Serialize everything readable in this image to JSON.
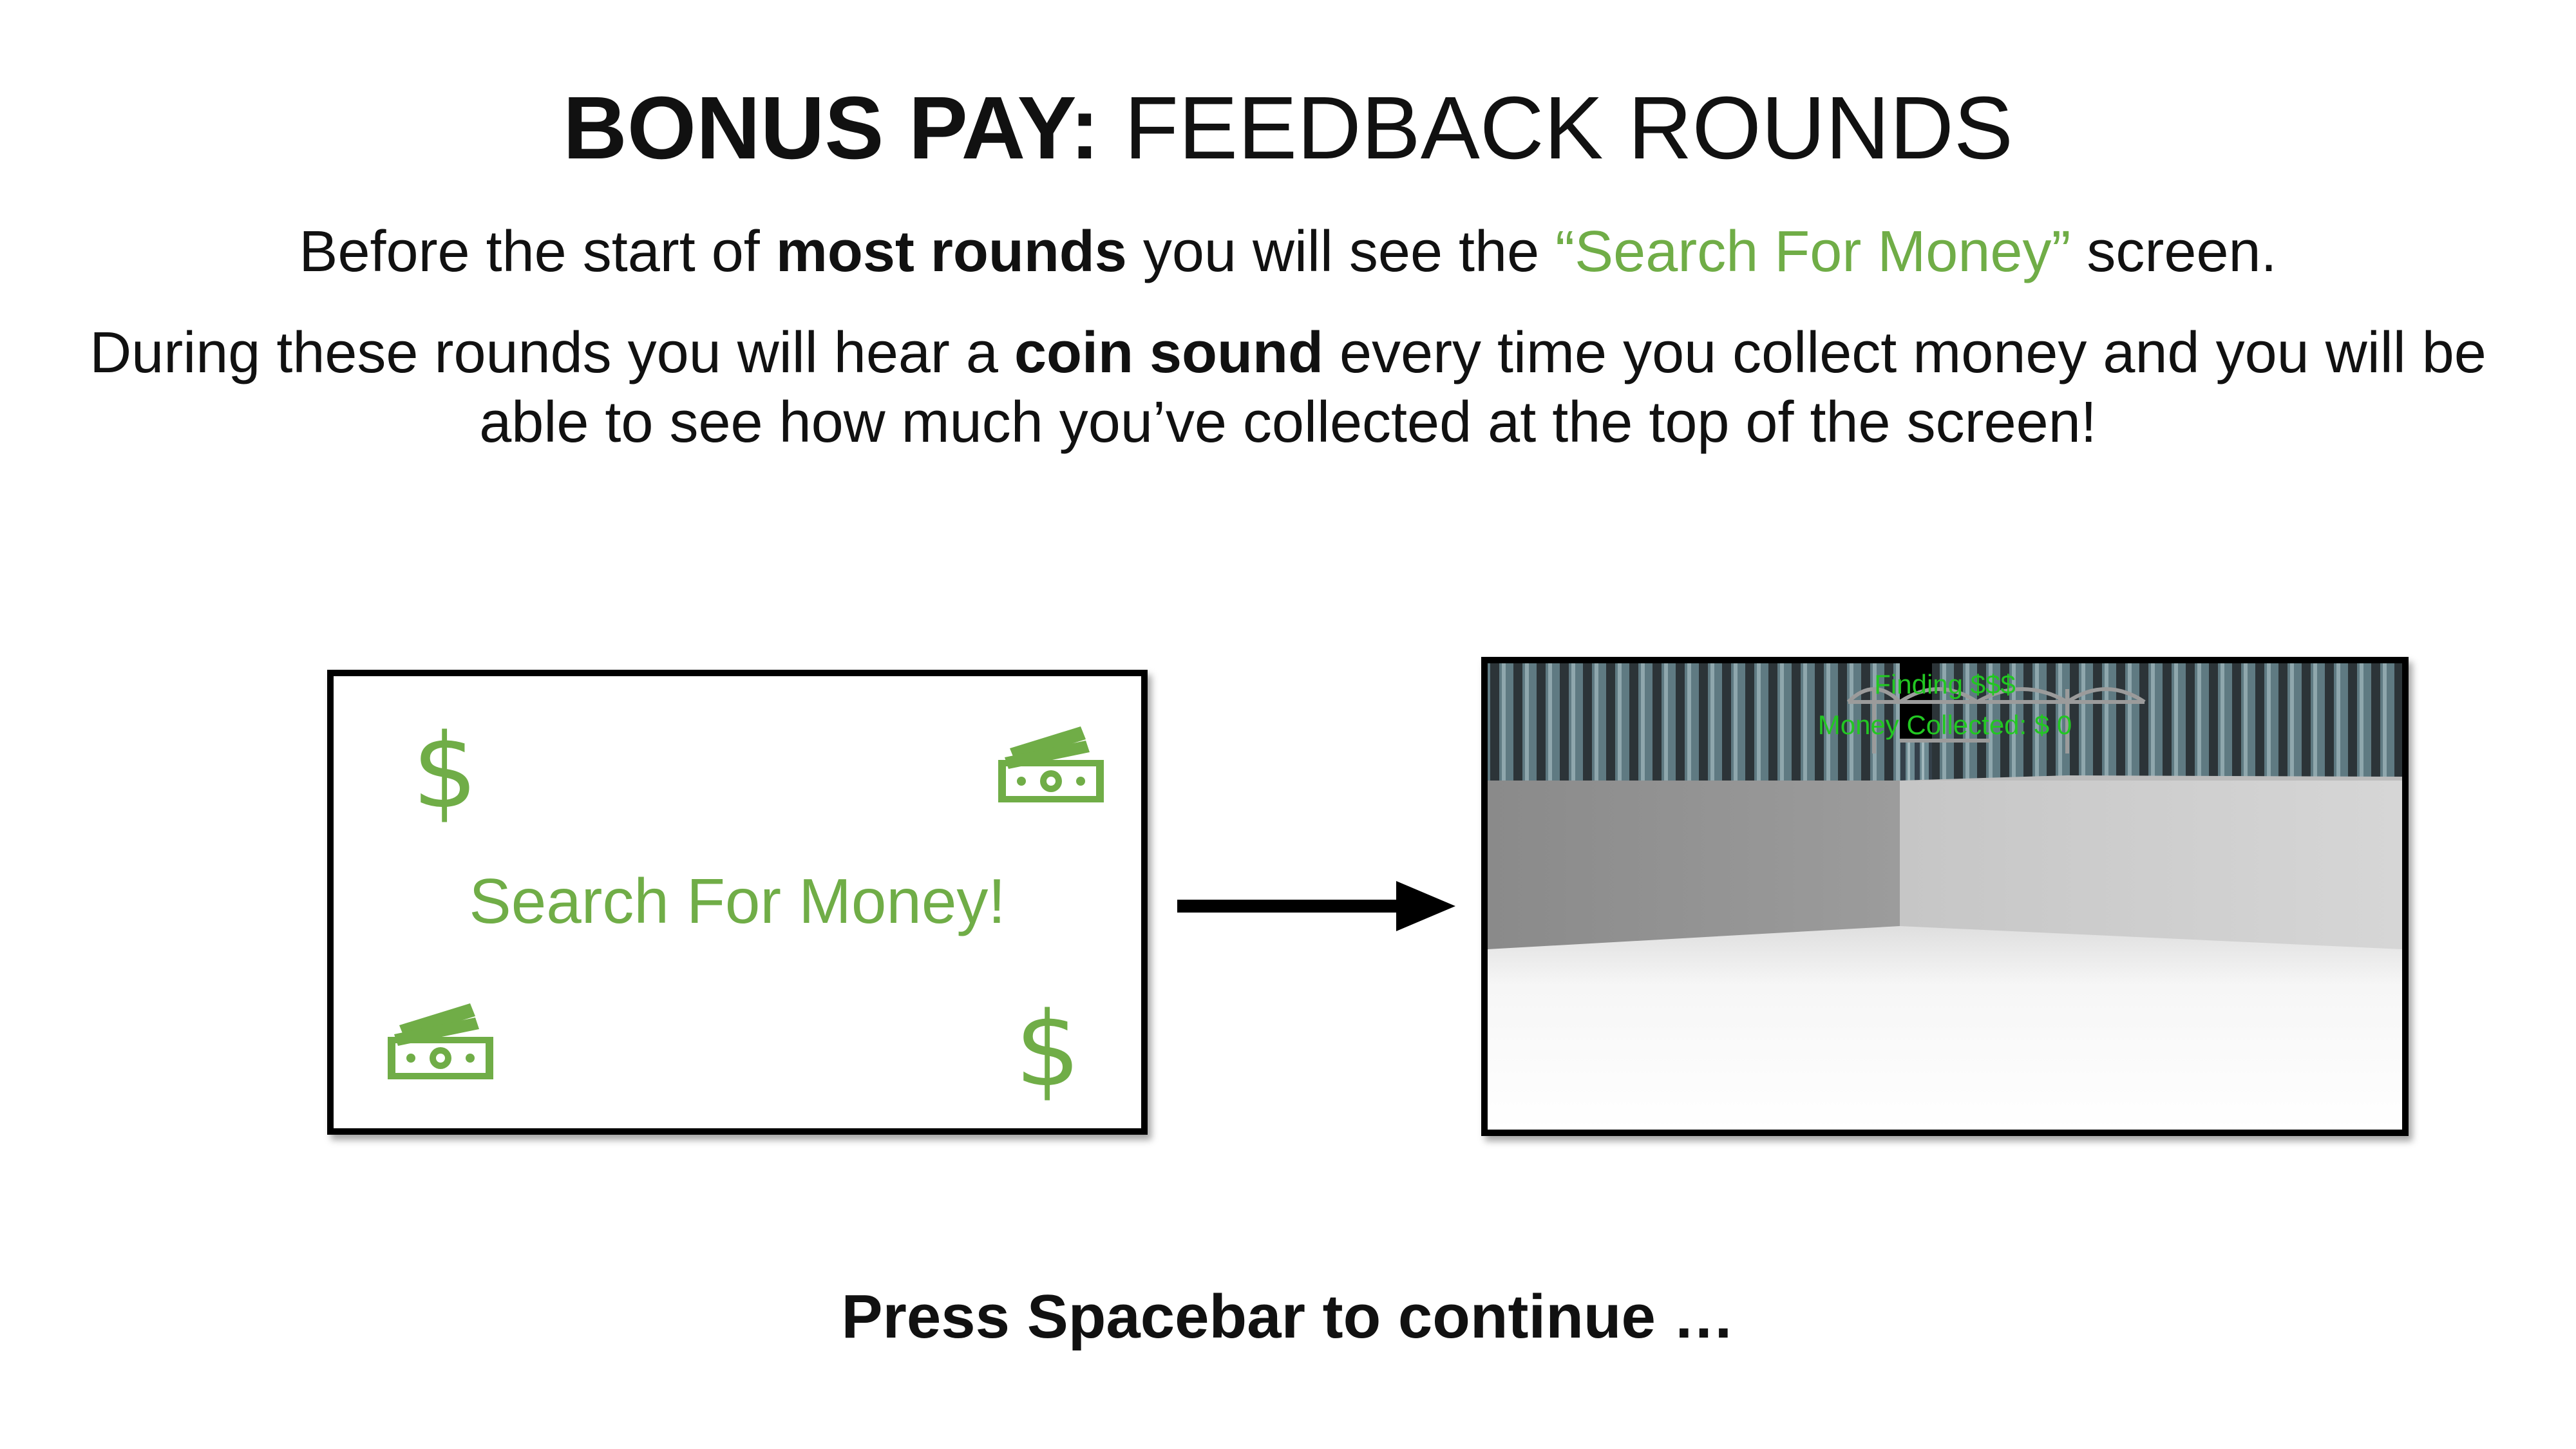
{
  "title": {
    "bold": "BONUS PAY:",
    "rest": "FEEDBACK ROUNDS"
  },
  "instructions": {
    "line1": {
      "before": "Before the start of ",
      "bold": "most rounds",
      "middle": " you will see the ",
      "green": "“Search For Money”",
      "after": " screen."
    },
    "line2": {
      "before": "During these rounds you will hear a ",
      "bold": "coin sound",
      "after": " every time you collect money and you will be able to see how much you’ve collected at the top of the screen!"
    }
  },
  "search_card": {
    "text": "Search For Money!",
    "dollar_symbol": "$",
    "icons": [
      "dollar-sign-icon",
      "money-bills-icon",
      "money-bills-icon",
      "dollar-sign-icon"
    ],
    "color": "#70ad47"
  },
  "game_preview": {
    "hud_line1": "Finding $$$",
    "hud_line2": "Money Collected: $ 0",
    "hud_color": "#22c722"
  },
  "prompt": "Press Spacebar to continue …",
  "colors": {
    "accent_green": "#70ad47",
    "text": "#111111",
    "border": "#000000"
  }
}
